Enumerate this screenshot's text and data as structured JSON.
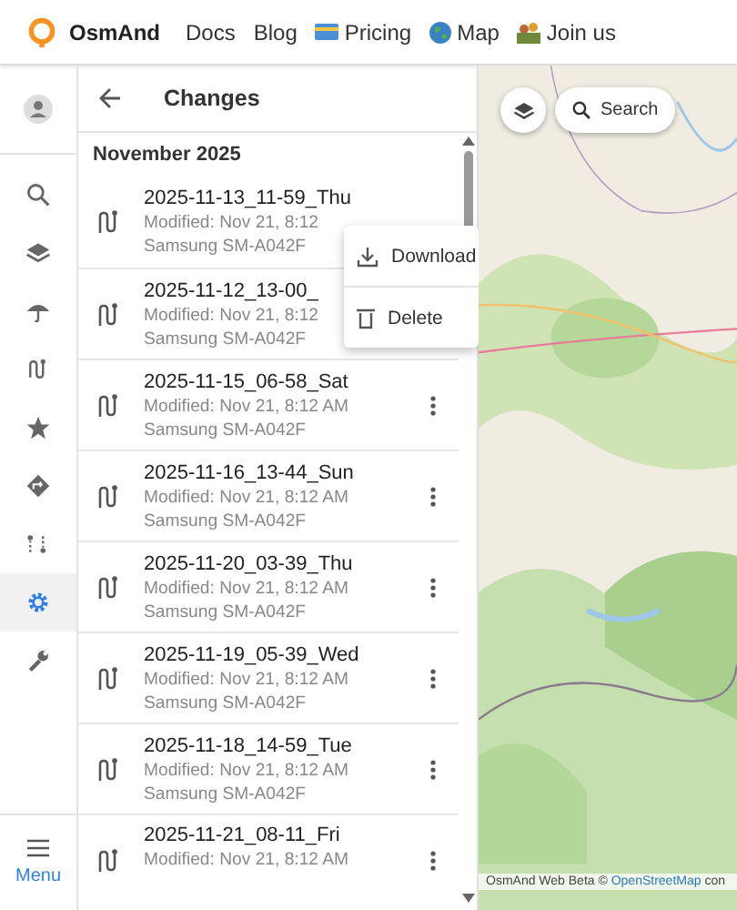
{
  "nav": {
    "brand": "OsmAnd",
    "links": [
      "Docs",
      "Blog",
      "Pricing",
      "Map",
      "Join us"
    ]
  },
  "rail": {
    "items": [
      {
        "selected": false
      },
      {
        "selected": false
      },
      {
        "selected": false
      },
      {
        "selected": false
      },
      {
        "selected": false
      },
      {
        "selected": false
      },
      {
        "selected": false
      },
      {
        "selected": true
      },
      {
        "selected": false
      }
    ],
    "menu_label": "Menu"
  },
  "panel": {
    "title": "Changes",
    "month": "November 2025",
    "rows": [
      {
        "title": "2025-11-13_11-59_Thu",
        "modified": "Modified: Nov 21, 8:12",
        "device": "Samsung SM-A042F",
        "more_button": false
      },
      {
        "title": "2025-11-12_13-00_",
        "modified": "Modified: Nov 21, 8:12",
        "device": "Samsung SM-A042F",
        "more_button": false
      },
      {
        "title": "2025-11-15_06-58_Sat",
        "modified": "Modified: Nov 21, 8:12 AM",
        "device": "Samsung SM-A042F",
        "more_button": true
      },
      {
        "title": "2025-11-16_13-44_Sun",
        "modified": "Modified: Nov 21, 8:12 AM",
        "device": "Samsung SM-A042F",
        "more_button": true
      },
      {
        "title": "2025-11-20_03-39_Thu",
        "modified": "Modified: Nov 21, 8:12 AM",
        "device": "Samsung SM-A042F",
        "more_button": true
      },
      {
        "title": "2025-11-19_05-39_Wed",
        "modified": "Modified: Nov 21, 8:12 AM",
        "device": "Samsung SM-A042F",
        "more_button": true
      },
      {
        "title": "2025-11-18_14-59_Tue",
        "modified": "Modified: Nov 21, 8:12 AM",
        "device": "Samsung SM-A042F",
        "more_button": true
      },
      {
        "title": "2025-11-21_08-11_Fri",
        "modified": "Modified: Nov 21, 8:12 AM",
        "more_button": true
      }
    ],
    "context_menu": [
      "Download",
      "Delete"
    ]
  },
  "map": {
    "search_label": "Search",
    "attribution": "OsmAnd Web Beta © ",
    "attribution_link": "OpenStreetMap",
    "attribution_tail": " con"
  }
}
